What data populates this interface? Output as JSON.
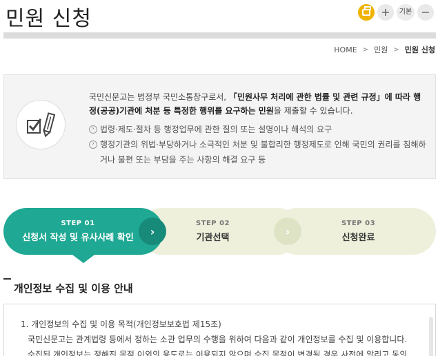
{
  "page": {
    "title": "민원 신청"
  },
  "tools": {
    "print_icon": "print-icon",
    "zoom_in": "+",
    "reset": "기본",
    "zoom_out": "−"
  },
  "breadcrumb": {
    "home": "HOME",
    "sep": ">",
    "level1": "민원",
    "current": "민원 신청"
  },
  "info": {
    "intro_1": "국민신문고는 범정부 국민소통창구로서, ",
    "intro_strong": "「민원사무 처리에 관한 법률 및 관련 규정」에 따라 행정(공공)기관에 처분 등 특정한 행위를 요구하는 민원",
    "intro_2": "을 제출할 수 있습니다.",
    "items": [
      "법령·제도·절차 등 행정업무에 관한 질의 또는 설명이나 해석의 요구",
      "행정기관의 위법·부당하거나 소극적인 처분 및 불합리한 행정제도로 인해 국민의 권리를 침해하거나 불편 또는 부담을 주는 사항의 해결 요구 등"
    ]
  },
  "steps": [
    {
      "num": "STEP 01",
      "title": "신청서 작성 및 유사사례 확인"
    },
    {
      "num": "STEP 02",
      "title": "기관선택"
    },
    {
      "num": "STEP 03",
      "title": "신청완료"
    }
  ],
  "arrow_glyph": "›",
  "section": {
    "title": "개인정보 수집 및 이용 안내"
  },
  "privacy": {
    "heading": "1. 개인정보의 수집 및 이용 목적(개인정보보호법 제15조)",
    "line1": "국민신문고는 관계법령 등에서 정하는 소관 업무의 수행을 위하여 다음과 같이 개인정보를 수집 및 이용합니다.",
    "line2": "수집된 개인정보는 정해진 목적 이외의 용도로는 이용되지 않으며 수집 목적이 변경될 경우 사전에 알리고 동의"
  },
  "colors": {
    "accent": "#1fa893",
    "accent_dark": "#178a79",
    "print": "#f0b400",
    "step_inactive": "#eef0dc"
  }
}
